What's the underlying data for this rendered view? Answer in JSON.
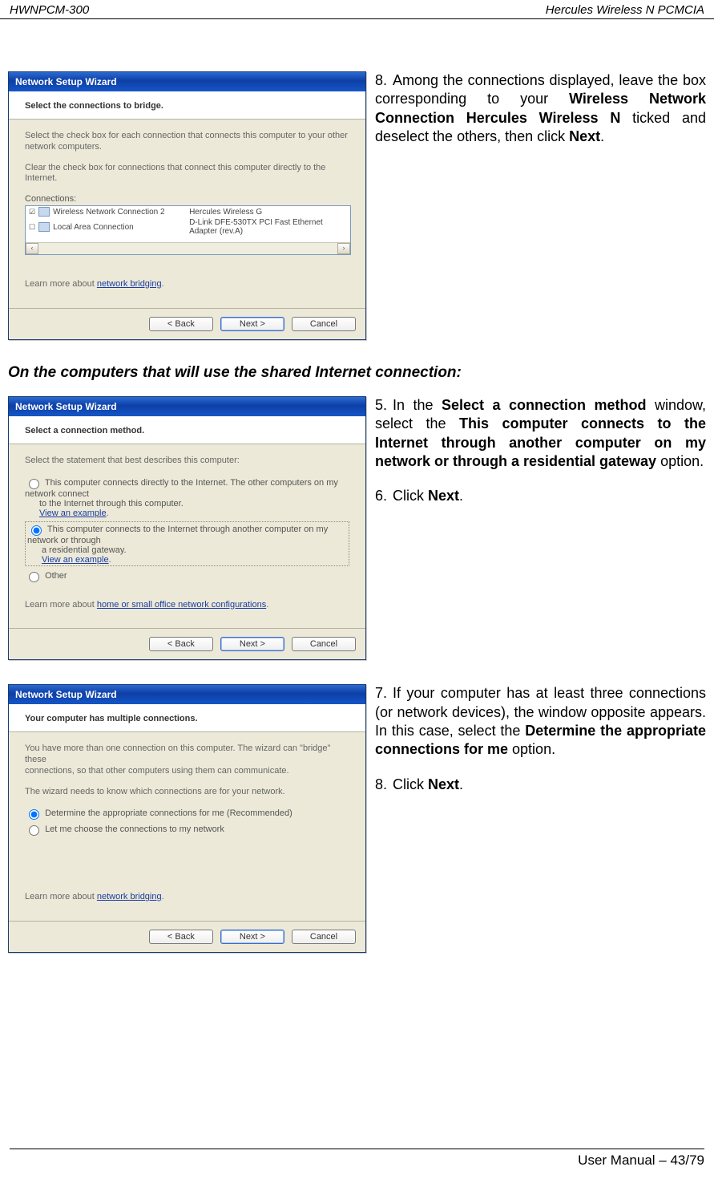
{
  "header": {
    "left": "HWNPCM-300",
    "right": "Hercules Wireless N PCMCIA"
  },
  "wiz1": {
    "title": "Network Setup Wizard",
    "heading": "Select the connections to bridge.",
    "line1": "Select the check box for each connection that connects this computer to your other network computers.",
    "line2": "Clear the check box for connections that connect this computer directly to the Internet.",
    "connections_label": "Connections:",
    "rows": [
      {
        "checked": true,
        "c1": "Wireless Network Connection 2",
        "c2": "Hercules Wireless G"
      },
      {
        "checked": false,
        "c1": "Local Area Connection",
        "c2": "D-Link DFE-530TX PCI Fast Ethernet Adapter (rev.A)"
      }
    ],
    "learn_prefix": "Learn more about ",
    "learn_link": "network bridging",
    "buttons": {
      "back": "< Back",
      "next": "Next >",
      "cancel": "Cancel"
    }
  },
  "step8a_text": "Among the connections displayed, leave the box corresponding to your <b>Wireless Network Connection Hercules Wireless N</b> ticked and deselect the others, then click <b>Next</b>.",
  "section_heading": "On the computers that will use the shared Internet connection:",
  "wiz2": {
    "title": "Network Setup Wizard",
    "heading": "Select a connection method.",
    "line1": "Select the statement that best describes this computer:",
    "opt1_a": "This computer connects directly to the Internet. The other computers on my network connect",
    "opt1_b": "to the Internet through this computer.",
    "opt2_a": "This computer connects to the Internet through another computer on my network or through",
    "opt2_b": "a residential gateway.",
    "opt3": "Other",
    "view_example": "View an example",
    "learn_prefix": "Learn more about ",
    "learn_link": "home or small office network configurations",
    "buttons": {
      "back": "< Back",
      "next": "Next >",
      "cancel": "Cancel"
    }
  },
  "step5_text": "In the <b>Select a connection method</b> window, select the <b>This computer connects to the Internet through another computer on my network or through a residential gateway</b> option.",
  "step6_text": "Click <b>Next</b>.",
  "wiz3": {
    "title": "Network Setup Wizard",
    "heading": "Your computer has multiple connections.",
    "line1a": "You have more than one connection on this computer. The wizard can \"bridge\" these",
    "line1b": "connections, so that other computers using them can communicate.",
    "line2": "The wizard needs to know which connections are for your network.",
    "opt1": "Determine the appropriate connections for me (Recommended)",
    "opt2": "Let me choose the connections to my network",
    "learn_prefix": "Learn more about ",
    "learn_link": "network bridging",
    "buttons": {
      "back": "< Back",
      "next": "Next >",
      "cancel": "Cancel"
    }
  },
  "step7_text": "If your computer has at least three connections (or network devices), the window opposite appears.  In this case, select the <b>Determine the appropriate connections for me</b> option.",
  "step8b_text": "Click <b>Next</b>.",
  "footer": "User Manual – 43/79"
}
